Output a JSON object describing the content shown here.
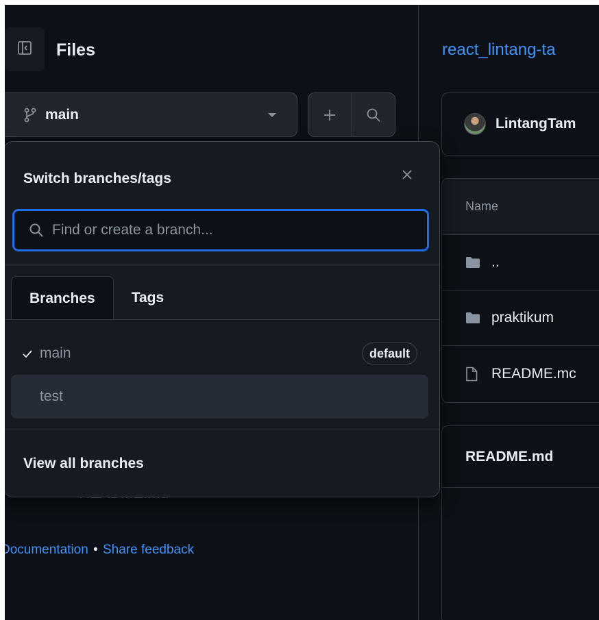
{
  "sidebar": {
    "title": "Files",
    "branch_selector": {
      "label": "main"
    },
    "ghost_file": "README.md",
    "footer": {
      "documentation": "Documentation",
      "separator": "•",
      "feedback": "Share feedback"
    }
  },
  "main": {
    "repo_breadcrumb": "react_lintang-ta",
    "commit_user": "LintangTam",
    "files": {
      "header": "Name",
      "rows": [
        {
          "name": "..",
          "icon": "folder-icon"
        },
        {
          "name": "praktikum",
          "icon": "folder-icon"
        },
        {
          "name": "README.mc",
          "icon": "file-icon"
        }
      ]
    },
    "readme_title": "README.md"
  },
  "branch_popover": {
    "title": "Switch branches/tags",
    "search": {
      "placeholder": "Find or create a branch...",
      "value": ""
    },
    "tabs": [
      {
        "label": "Branches",
        "active": true
      },
      {
        "label": "Tags",
        "active": false
      }
    ],
    "branches": [
      {
        "name": "main",
        "selected": true,
        "badge": "default"
      },
      {
        "name": "test",
        "selected": false,
        "badge": ""
      }
    ],
    "footer_link": "View all branches"
  },
  "colors": {
    "background": "#0d1117",
    "overlay": "#161b22",
    "accent_blue": "#4493f8",
    "focus_ring": "#1f6feb",
    "border": "#30363d",
    "muted_text": "#8b949e"
  }
}
